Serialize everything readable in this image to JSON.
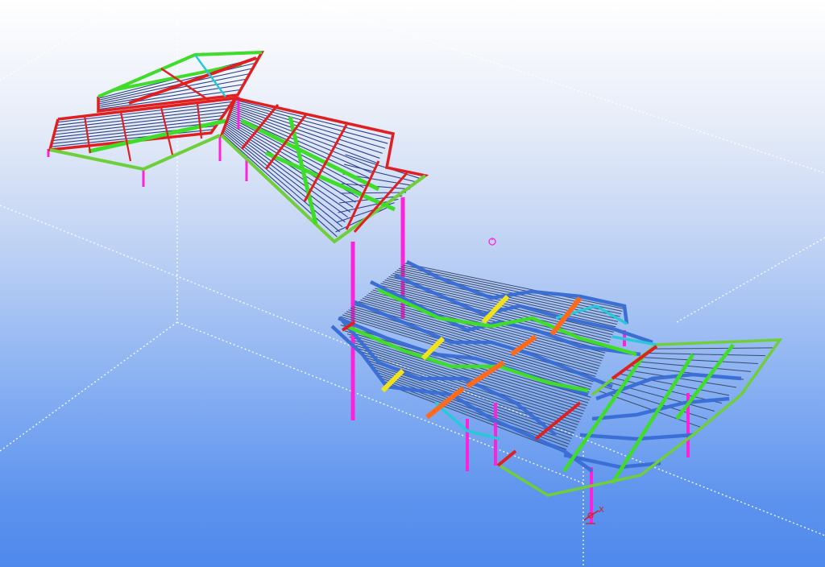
{
  "viewport": {
    "colors": {
      "bg_top": "#ffffff",
      "bg_bottom": "#4f89ec",
      "primary_beam": "#e02020",
      "secondary_beam": "#3fdc2a",
      "edge_beam": "#6fcf3a",
      "purlin": "#2b3f8f",
      "rafter": "#3b6fd6",
      "column": "#ff22dd",
      "accent_orange": "#ff6a1a",
      "accent_yellow": "#f2e21a",
      "accent_cyan": "#27c8d8",
      "grid_line": "#ffffff"
    },
    "icons": {
      "origin_marker": "coordinate-axes-icon",
      "view_center": "rotation-center-icon"
    },
    "origin": {
      "axis_x_label": "X"
    }
  }
}
